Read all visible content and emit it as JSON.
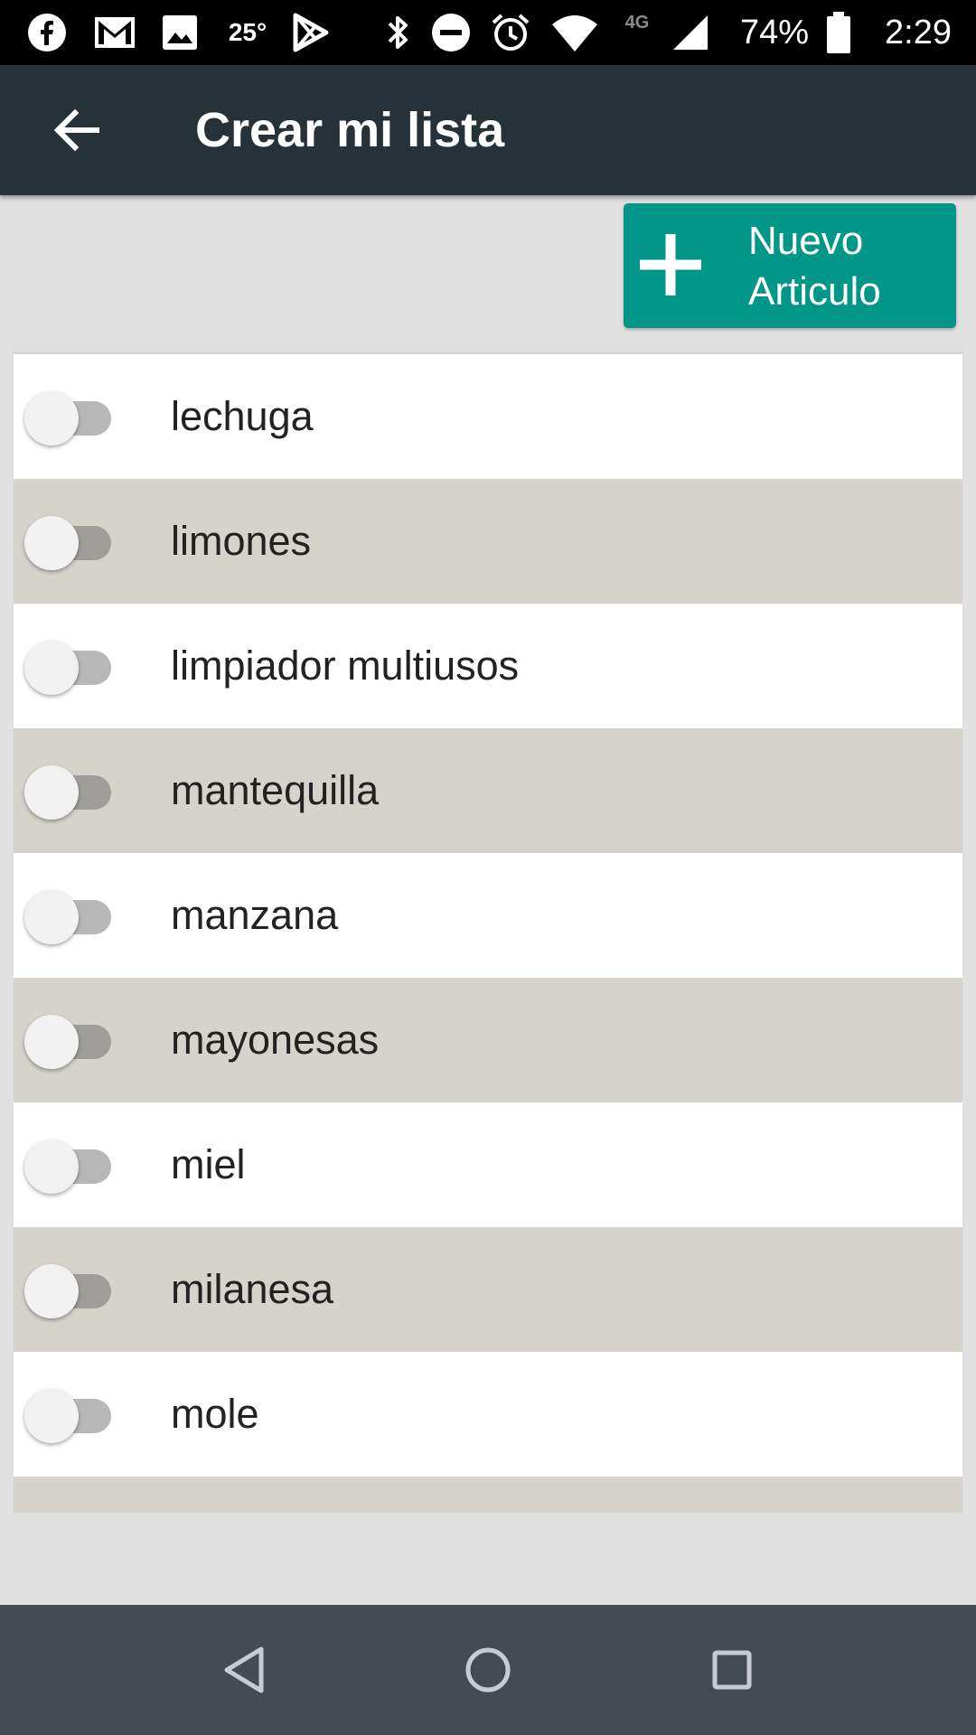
{
  "status_bar": {
    "temperature": "25°",
    "network": "4G",
    "battery": "74%",
    "time": "2:29",
    "icons": [
      "facebook-icon",
      "gmail-icon",
      "gallery-icon",
      "play-store-icon",
      "bluetooth-icon",
      "dnd-icon",
      "alarm-icon",
      "wifi-icon",
      "signal-icon",
      "battery-icon"
    ]
  },
  "app_bar": {
    "title": "Crear mi lista",
    "back_icon": "arrow-back-icon"
  },
  "add_button": {
    "line1": "Nuevo",
    "line2": "Articulo",
    "icon": "plus-icon",
    "color": "#009688"
  },
  "items": [
    {
      "label": "lechuga",
      "checked": false
    },
    {
      "label": "limones",
      "checked": false
    },
    {
      "label": "limpiador multiusos",
      "checked": false
    },
    {
      "label": "mantequilla",
      "checked": false
    },
    {
      "label": "manzana",
      "checked": false
    },
    {
      "label": "mayonesas",
      "checked": false
    },
    {
      "label": "miel",
      "checked": false
    },
    {
      "label": "milanesa",
      "checked": false
    },
    {
      "label": "mole",
      "checked": false
    }
  ],
  "nav_bar": {
    "icons": [
      "back-triangle-icon",
      "home-circle-icon",
      "recents-square-icon"
    ]
  },
  "colors": {
    "app_bar": "#263238",
    "accent": "#009688",
    "row_alt": "#d6d3cd",
    "background": "#e0e0e0"
  }
}
